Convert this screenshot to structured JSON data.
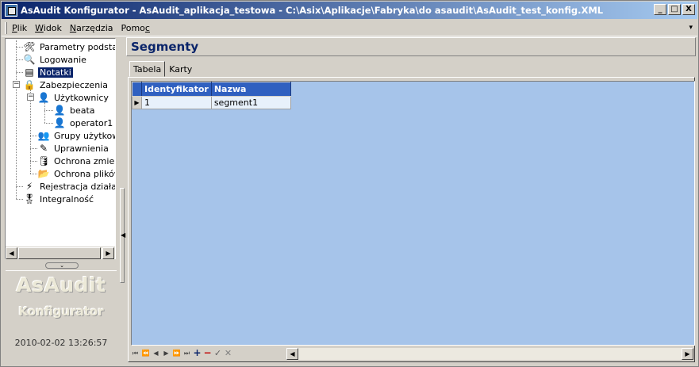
{
  "window": {
    "title": "AsAudit Konfigurator - AsAudit_aplikacja_testowa - C:\\Asix\\Aplikacje\\Fabryka\\do asaudit\\AsAudit_test_konfig.XML",
    "minimize": "_",
    "maximize": "□",
    "close": "X"
  },
  "menu": [
    {
      "pre": "",
      "u": "P",
      "post": "lik"
    },
    {
      "pre": "",
      "u": "W",
      "post": "idok"
    },
    {
      "pre": "",
      "u": "N",
      "post": "arzędzia"
    },
    {
      "pre": "Pomo",
      "u": "c",
      "post": ""
    }
  ],
  "tree": {
    "items": [
      {
        "label": "Parametry podstawowe",
        "icon": "tools-icon",
        "glyph": "🛠"
      },
      {
        "label": "Logowanie",
        "icon": "magnifier-icon",
        "glyph": "🔍"
      },
      {
        "label": "Notatki",
        "icon": "note-icon",
        "glyph": "▤"
      },
      {
        "label": "Zabezpieczenia",
        "icon": "lock-icon",
        "glyph": "🔒"
      },
      {
        "label": "Użytkownicy",
        "icon": "user-blue-icon",
        "glyph": "👤"
      },
      {
        "label": "beata",
        "icon": "user-green-icon",
        "glyph": "👤"
      },
      {
        "label": "operator1",
        "icon": "user-green-icon",
        "glyph": "👤"
      },
      {
        "label": "Grupy użytkowników",
        "icon": "group-icon",
        "glyph": "👥"
      },
      {
        "label": "Uprawnienia",
        "icon": "wand-icon",
        "glyph": "✎"
      },
      {
        "label": "Ochrona zmiennych",
        "icon": "database-icon",
        "glyph": "🛢"
      },
      {
        "label": "Ochrona plików",
        "icon": "folder-icon",
        "glyph": "📂"
      },
      {
        "label": "Rejestracja działań",
        "icon": "lightning-icon",
        "glyph": "⚡"
      },
      {
        "label": "Integralność",
        "icon": "award-icon",
        "glyph": "🎖"
      }
    ],
    "expander_minus": "−"
  },
  "brand": {
    "title": "AsAudit",
    "subtitle": "Konfigurator",
    "timestamp": "2010-02-02 13:26:57"
  },
  "main": {
    "section_title": "Segmenty",
    "tabs": [
      "Tabela",
      "Karty"
    ],
    "grid": {
      "columns": [
        "Identyfikator",
        "Nazwa"
      ],
      "rows": [
        {
          "indicator": "▶",
          "id": "1",
          "name": "segment1"
        }
      ]
    },
    "navigator": {
      "first": "⏮",
      "prior_page": "⏪",
      "prior": "◀",
      "next": "▶",
      "next_page": "⏩",
      "last": "⏭",
      "insert": "+",
      "delete": "−",
      "post": "✓",
      "cancel": "✕"
    }
  },
  "scroll": {
    "left": "◀",
    "right": "▶",
    "collapse": "⌄",
    "splitter": "◀"
  }
}
